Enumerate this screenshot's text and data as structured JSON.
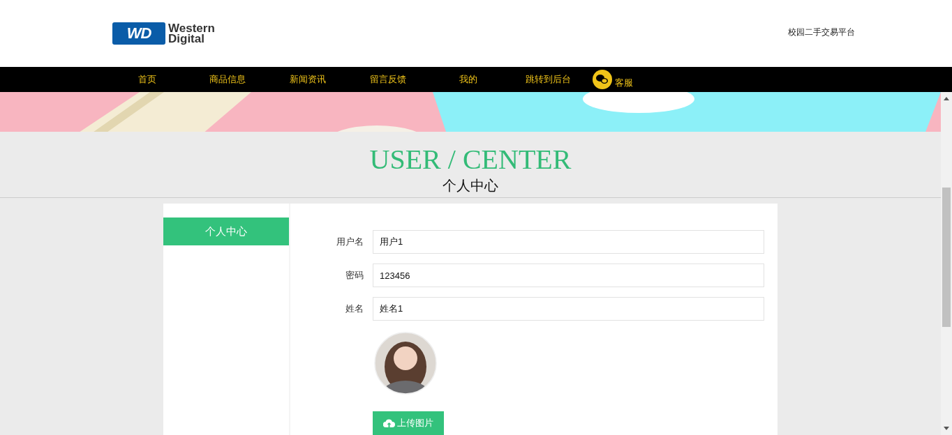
{
  "header": {
    "logo": {
      "mark": "WD",
      "words": [
        "Western",
        "Digital"
      ]
    },
    "site_name": "校园二手交易平台"
  },
  "nav": [
    {
      "label": "首页",
      "kind": "text"
    },
    {
      "label": "商品信息",
      "kind": "text"
    },
    {
      "label": "新闻资讯",
      "kind": "text"
    },
    {
      "label": "留言反馈",
      "kind": "text"
    },
    {
      "label": "我的",
      "kind": "text"
    },
    {
      "label": "跳转到后台",
      "kind": "text"
    },
    {
      "label": "客服",
      "kind": "chat"
    }
  ],
  "section": {
    "title": "USER / CENTER",
    "subtitle": "个人中心"
  },
  "sidebar": {
    "items": [
      {
        "label": "个人中心",
        "selected": true
      }
    ]
  },
  "form": {
    "fields": [
      {
        "label": "用户名",
        "value": "用户1"
      },
      {
        "label": "密码",
        "value": "123456"
      },
      {
        "label": "姓名",
        "value": "姓名1"
      }
    ],
    "upload_button": "上传图片"
  }
}
